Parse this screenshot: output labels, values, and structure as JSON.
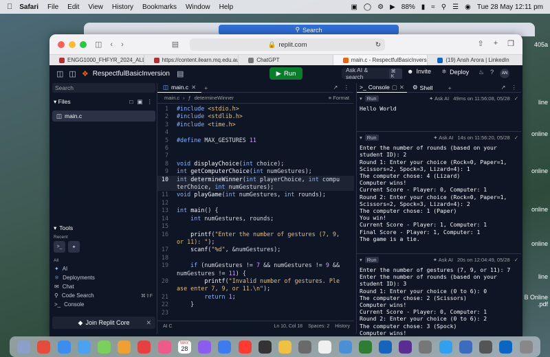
{
  "menubar": {
    "app": "Safari",
    "items": [
      "File",
      "Edit",
      "View",
      "History",
      "Bookmarks",
      "Window",
      "Help"
    ],
    "battery": "88%",
    "datetime": "Tue 28 May  12:11 pm"
  },
  "desktop": {
    "right_labels": [
      "405a",
      "line",
      "online",
      "online",
      "online",
      "online",
      "line",
      "B Online",
      ".pdf"
    ]
  },
  "back_window": {
    "search_label": "Search"
  },
  "browser": {
    "url": "replit.com",
    "tabs": [
      {
        "label": "ENGG1000_FHFYR_2024_ALL_U...",
        "color": "#b53030"
      },
      {
        "label": "https://content.ilearn.mq.edu.au/4...",
        "color": "#b53030"
      },
      {
        "label": "ChatGPT",
        "color": "#777777"
      },
      {
        "label": "main.c - RespectfulBasicInversion...",
        "color": "#f26207"
      },
      {
        "label": "(19) Ansh Arora | LinkedIn",
        "color": "#0a66c2"
      }
    ]
  },
  "replit": {
    "repl_name": "RespectfulBasicInversion",
    "run_label": "Run",
    "ask_search": "Ask AI & search",
    "ask_kbd": "⌘ K",
    "invite_label": "Invite",
    "deploy_label": "Deploy",
    "avatar": "AN",
    "sidebar": {
      "search_placeholder": "Search",
      "files_label": "Files",
      "file": "main.c",
      "tools_label": "Tools",
      "recent_label": "Recent",
      "all_label": "All",
      "tools": [
        {
          "label": "AI",
          "kbd": ""
        },
        {
          "label": "Deployments",
          "kbd": ""
        },
        {
          "label": "Chat",
          "kbd": ""
        },
        {
          "label": "Code Search",
          "kbd": "⌘⇧F"
        },
        {
          "label": "Console",
          "kbd": ""
        }
      ],
      "join_core": "Join Replit Core"
    },
    "editor": {
      "tab": "main.c",
      "crumb_file": "main.c",
      "crumb_fn": "determineWinner",
      "format_label": "Format",
      "status_left": "AI  C",
      "status_pos": "Ln 10, Col 18",
      "status_spaces": "Spaces: 2",
      "status_history": "History",
      "lines": [
        {
          "n": "1",
          "html": "<span class='kw'>#include</span> <span class='st'>&lt;stdio.h&gt;</span>"
        },
        {
          "n": "2",
          "html": "<span class='kw'>#include</span> <span class='st'>&lt;stdlib.h&gt;</span>"
        },
        {
          "n": "3",
          "html": "<span class='kw'>#include</span> <span class='st'>&lt;time.h&gt;</span>"
        },
        {
          "n": "4",
          "html": ""
        },
        {
          "n": "5",
          "html": "<span class='kw'>#define</span> MAX_GESTURES <span class='nu'>11</span>"
        },
        {
          "n": "6",
          "html": ""
        },
        {
          "n": "7",
          "html": ""
        },
        {
          "n": "8",
          "html": "<span class='ty'>void</span> <span class='fn'>displayChoice</span>(<span class='ty'>int</span> choice);"
        },
        {
          "n": "9",
          "html": "<span class='ty'>int</span> <span class='fn'>getComputerChoice</span>(<span class='ty'>int</span> numGestures);"
        },
        {
          "n": "10",
          "html": "<span class='ty'>int</span> <span class='fn'>determineWinner</span>(<span class='ty'>int</span> playerChoice, <span class='ty'>int</span> computerChoice, <span class='ty'>int</span> numGestures);",
          "cur": true
        },
        {
          "n": "11",
          "html": "<span class='ty'>void</span> <span class='fn'>playGame</span>(<span class='ty'>int</span> numGestures, <span class='ty'>int</span> rounds);"
        },
        {
          "n": "12",
          "html": ""
        },
        {
          "n": "13",
          "html": "<span class='ty'>int</span> <span class='fn'>main</span>() {"
        },
        {
          "n": "14",
          "html": "    <span class='ty'>int</span> numGestures, rounds;"
        },
        {
          "n": "15",
          "html": ""
        },
        {
          "n": "16",
          "html": "    <span class='fn'>printf</span>(<span class='st'>\"Enter the number of gestures (7, 9, or 11): \"</span>);"
        },
        {
          "n": "17",
          "html": "    <span class='fn'>scanf</span>(<span class='st'>\"%d\"</span>, &amp;numGestures);"
        },
        {
          "n": "18",
          "html": ""
        },
        {
          "n": "19",
          "html": "    <span class='kw'>if</span> (numGestures != <span class='nu'>7</span> &amp;&amp; numGestures != <span class='nu'>9</span> &amp;&amp; numGestures != <span class='nu'>11</span>) {"
        },
        {
          "n": "20",
          "html": "        <span class='fn'>printf</span>(<span class='st'>\"Invalid number of gestures. Please enter 7, 9, or 11.\\n\"</span>);"
        },
        {
          "n": "21",
          "html": "        <span class='kw'>return</span> <span class='nu'>1</span>;"
        },
        {
          "n": "22",
          "html": "    }"
        },
        {
          "n": "23",
          "html": ""
        }
      ]
    },
    "console": {
      "tab_console": "Console",
      "tab_shell": "Shell",
      "runs": [
        {
          "tag": "Run",
          "ask": "Ask AI",
          "time": "49ms on 11:56:08, 05/28",
          "output": "Hello World"
        },
        {
          "tag": "Run",
          "ask": "Ask AI",
          "time": "14s on 11:56:20, 05/28",
          "output": "Enter the number of rounds (based on your student ID): 2\nRound 1: Enter your choice (Rock=0, Paper=1, Scissors=2, Spock=3, Lizard=4): 1\nThe computer chose: 4 (Lizard)\nComputer wins!\nCurrent Score - Player: 0, Computer: 1\nRound 2: Enter your choice (Rock=0, Paper=1, Scissors=2, Spock=3, Lizard=4): 2\nThe computer chose: 1 (Paper)\nYou win!\nCurrent Score - Player: 1, Computer: 1\nFinal Score - Player: 1, Computer: 1\nThe game is a tie."
        },
        {
          "tag": "Run",
          "ask": "Ask AI",
          "time": "20s on 12:04:49, 05/28",
          "output": "Enter the number of gestures (7, 9, or 11): 7\nEnter the number of rounds (based on your student ID): 3\nRound 1: Enter your choice (0 to 6): 0\nThe computer chose: 2 (Scissors)\nComputer wins!\nCurrent Score - Player: 0, Computer: 1\nRound 2: Enter your choice (0 to 6): 2\nThe computer chose: 3 (Spock)\nComputer wins!\nCurrent Score - Player: 0, Computer: 2\nRound 3: Enter your choice (0 to 6): 5\nThe computer chose: 3 (Spock)"
        }
      ]
    }
  },
  "dock": {
    "calendar_month": "MAY",
    "calendar_day": "28",
    "icon_colors": [
      "#8aa0c8",
      "#e64c3c",
      "#3a8ef0",
      "#4aa3f0",
      "#7ad05a",
      "#f0a030",
      "#e84040",
      "#f05a8a",
      "#ffffff",
      "#8c5cf0",
      "#3c7cf0",
      "#ff3b30",
      "#333333",
      "#f0c040",
      "#6a6a6a",
      "#f0f0f0",
      "#4a90d9",
      "#2e7d32",
      "#1565c0",
      "#5c2d91",
      "#777777",
      "#30a0f0",
      "#3c6cc0",
      "#555555",
      "#0a66c2",
      "#888888"
    ]
  }
}
